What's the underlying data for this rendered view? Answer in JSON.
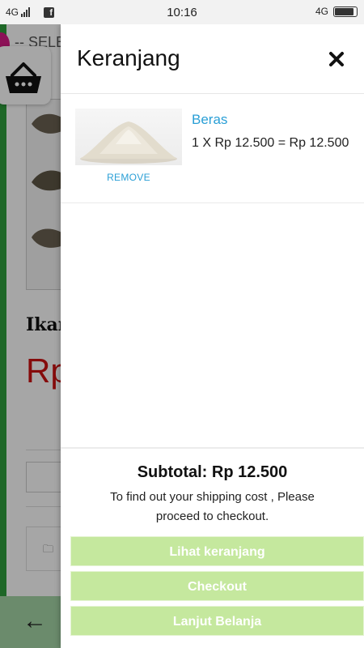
{
  "status_bar": {
    "network_left": "4G",
    "time": "10:16",
    "network_right": "4G"
  },
  "background_page": {
    "select_placeholder": "-- SELE",
    "product_name": "Ikan",
    "product_price": "Rp",
    "back_arrow": "←"
  },
  "drawer": {
    "title": "Keranjang",
    "items": [
      {
        "name": "Beras",
        "quantity_line": "1 X Rp 12.500 = Rp 12.500",
        "remove_label": "REMOVE"
      }
    ],
    "subtotal": "Subtotal: Rp 12.500",
    "shipping_note": "To find out your shipping cost , Please proceed to checkout.",
    "buttons": {
      "view_cart": "Lihat keranjang",
      "checkout": "Checkout",
      "continue_shopping": "Lanjut Belanja"
    }
  },
  "colors": {
    "accent": "#2a9fd6",
    "button": "#c5e89e",
    "brand_green": "#2e9e3c",
    "price_red": "#cc1111"
  },
  "icons": [
    "signal-icon",
    "facebook-icon",
    "battery-icon",
    "basket-icon",
    "close-icon",
    "folder-icon",
    "back-arrow-icon"
  ]
}
